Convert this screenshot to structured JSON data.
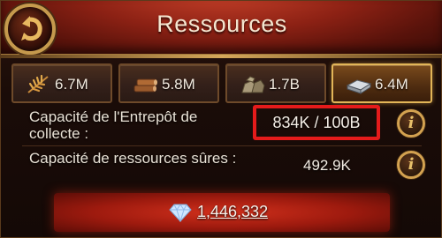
{
  "header": {
    "title": "Ressources"
  },
  "resources": [
    {
      "icon": "food-icon",
      "value": "6.7M",
      "active": false
    },
    {
      "icon": "wood-icon",
      "value": "5.8M",
      "active": false
    },
    {
      "icon": "stone-icon",
      "value": "1.7B",
      "active": false
    },
    {
      "icon": "iron-icon",
      "value": "6.4M",
      "active": true
    }
  ],
  "info": {
    "warehouse_label": "Capacité de l'Entrepôt de collecte :",
    "warehouse_value": "834K / 100B",
    "safe_label": "Capacité de ressources sûres :",
    "safe_value": "492.9K"
  },
  "gems": {
    "value": "1,446,332"
  },
  "colors": {
    "highlight_box": "#e41b1b",
    "gold_border": "#d3a250",
    "header_red": "#8c2114"
  }
}
